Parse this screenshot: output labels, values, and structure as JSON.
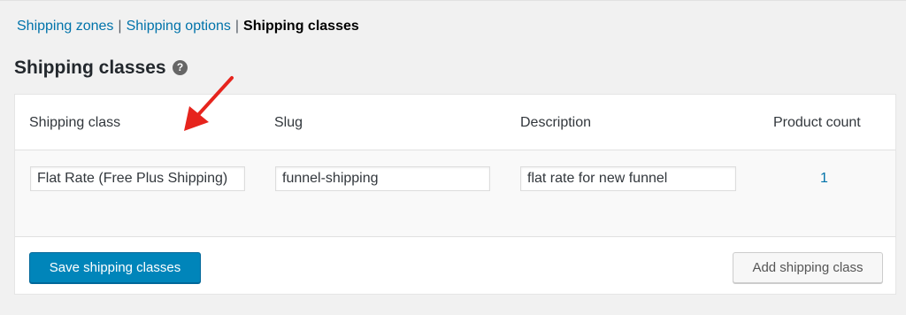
{
  "subnav": {
    "zones_label": "Shipping zones",
    "options_label": "Shipping options",
    "classes_label": "Shipping classes",
    "separator": "|"
  },
  "page": {
    "title": "Shipping classes",
    "help_glyph": "?"
  },
  "table": {
    "columns": {
      "shipping_class": "Shipping class",
      "slug": "Slug",
      "description": "Description",
      "product_count": "Product count"
    },
    "rows": [
      {
        "shipping_class": "Flat Rate (Free Plus Shipping)",
        "slug": "funnel-shipping",
        "description": "flat rate for new funnel",
        "product_count": "1"
      }
    ]
  },
  "footer": {
    "save_label": "Save shipping classes",
    "add_label": "Add shipping class"
  },
  "colors": {
    "link": "#0073aa",
    "primary_button": "#0085ba",
    "annotation_arrow": "#e6241d"
  },
  "icons": {
    "help": "help-icon",
    "annotation": "red-arrow-icon"
  }
}
